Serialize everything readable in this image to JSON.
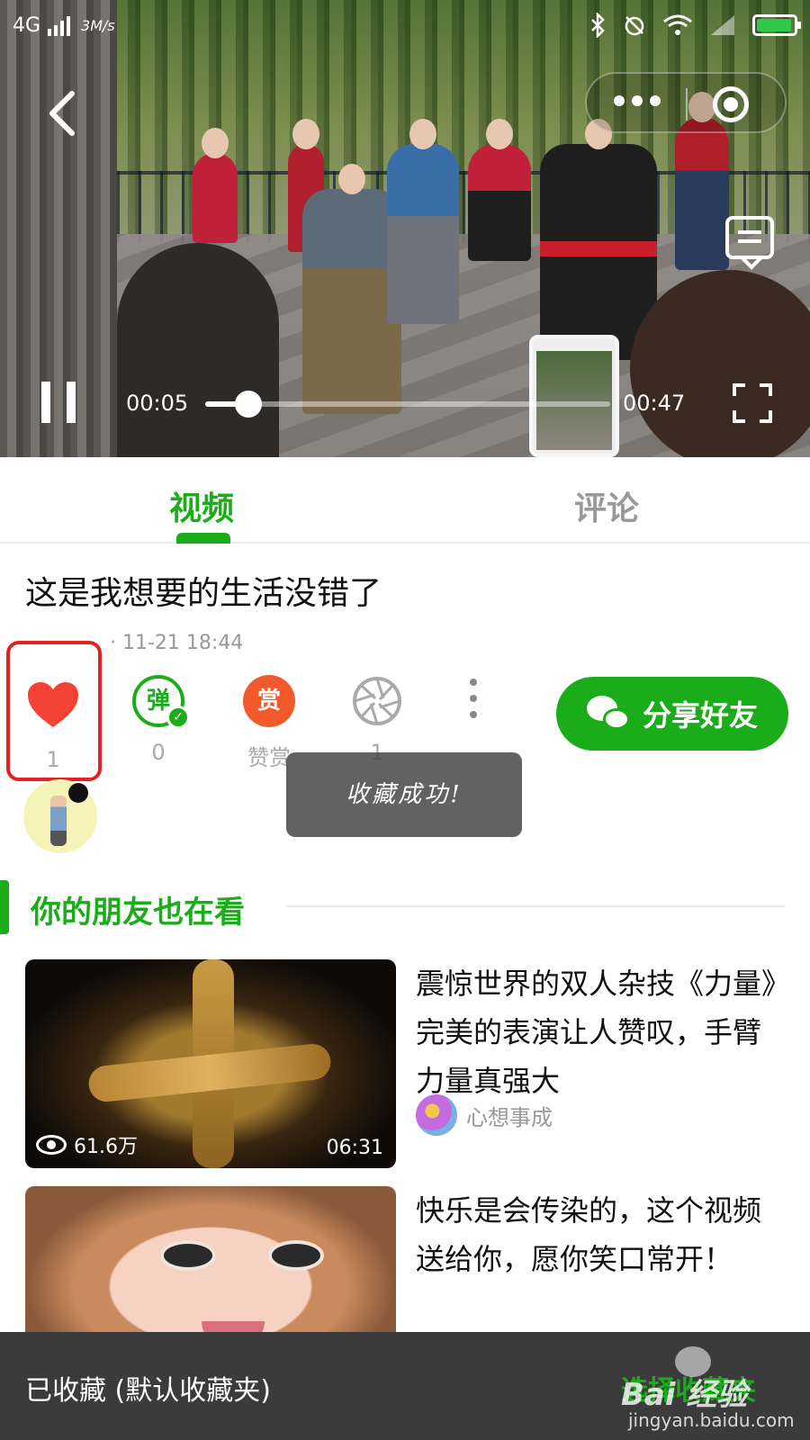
{
  "status_bar": {
    "network": "4G",
    "speed": "3M/s"
  },
  "player": {
    "current_time": "00:05",
    "total_time": "00:47",
    "progress": 0.106
  },
  "tabs": [
    {
      "label": "视频",
      "active": true
    },
    {
      "label": "评论",
      "active": false
    }
  ],
  "video": {
    "title": "这是我想要的生活没错了",
    "publish_time": "· 11-21 18:44"
  },
  "actions": {
    "like_count": "1",
    "danmu_label": "弹",
    "danmu_count": "0",
    "reward_label": "赏",
    "reward_text": "赞赏",
    "shutter_count": "1",
    "share_label": "分享好友"
  },
  "toast": "收藏成功!",
  "section": {
    "title": "你的朋友也在看"
  },
  "recommendations": [
    {
      "title": "震惊世界的双人杂技《力量》完美的表演让人赞叹，手臂力量真强大",
      "views": "61.6万",
      "duration": "06:31",
      "author": "心想事成"
    },
    {
      "title": "快乐是会传染的，这个视频送给你，愿你笑口常开！"
    }
  ],
  "snackbar": {
    "text": "已收藏 (默认收藏夹)",
    "action": "选择收藏夹"
  },
  "watermark": {
    "brand": "Bai 经验",
    "url": "jingyan.baidu.com"
  },
  "colors": {
    "accent": "#1aad19",
    "highlight": "#e02222",
    "like": "#f44336",
    "reward": "#f25a2c"
  }
}
